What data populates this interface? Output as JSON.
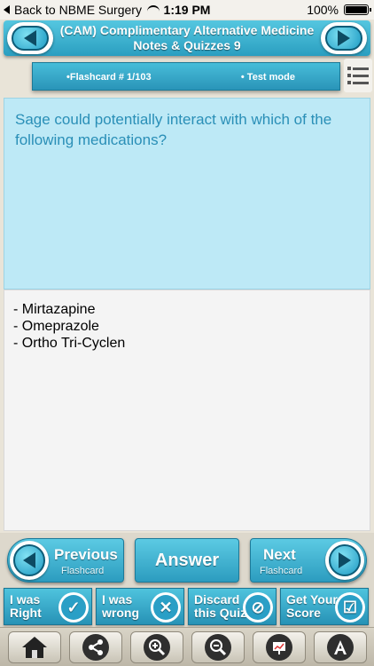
{
  "status_bar": {
    "back_label": "Back to NBME Surgery",
    "time": "1:19 PM",
    "battery": "100%"
  },
  "header": {
    "title_line1": "(CAM) Complimentary Alternative Medicine",
    "title_line2": "Notes & Quizzes 9"
  },
  "info_bar": {
    "flashcard": "•Flashcard #  1/103",
    "mode": "• Test mode"
  },
  "question": {
    "text": "Sage could potentially interact with which of the following medications?"
  },
  "answer": {
    "lines": [
      "- Mirtazapine",
      "- Omeprazole",
      "- Ortho Tri-Cyclen"
    ]
  },
  "controls": {
    "previous_label": "Previous",
    "previous_sub": "Flashcard",
    "answer_label": "Answer",
    "next_label": "Next",
    "next_sub": "Flashcard"
  },
  "secondary": {
    "right": [
      "I was",
      "Right"
    ],
    "wrong": [
      "I was",
      "wrong"
    ],
    "discard": [
      "Discard",
      "this Quiz"
    ],
    "score": [
      "Get Your",
      "Score"
    ]
  },
  "icons": {
    "toolbar": [
      "home-icon",
      "share-icon",
      "zoom-in-icon",
      "zoom-out-icon",
      "presentation-icon",
      "font-icon"
    ]
  },
  "colors": {
    "accent": "#2a9ec0",
    "question_bg": "#bde9f6",
    "question_text": "#2a8fb7"
  }
}
